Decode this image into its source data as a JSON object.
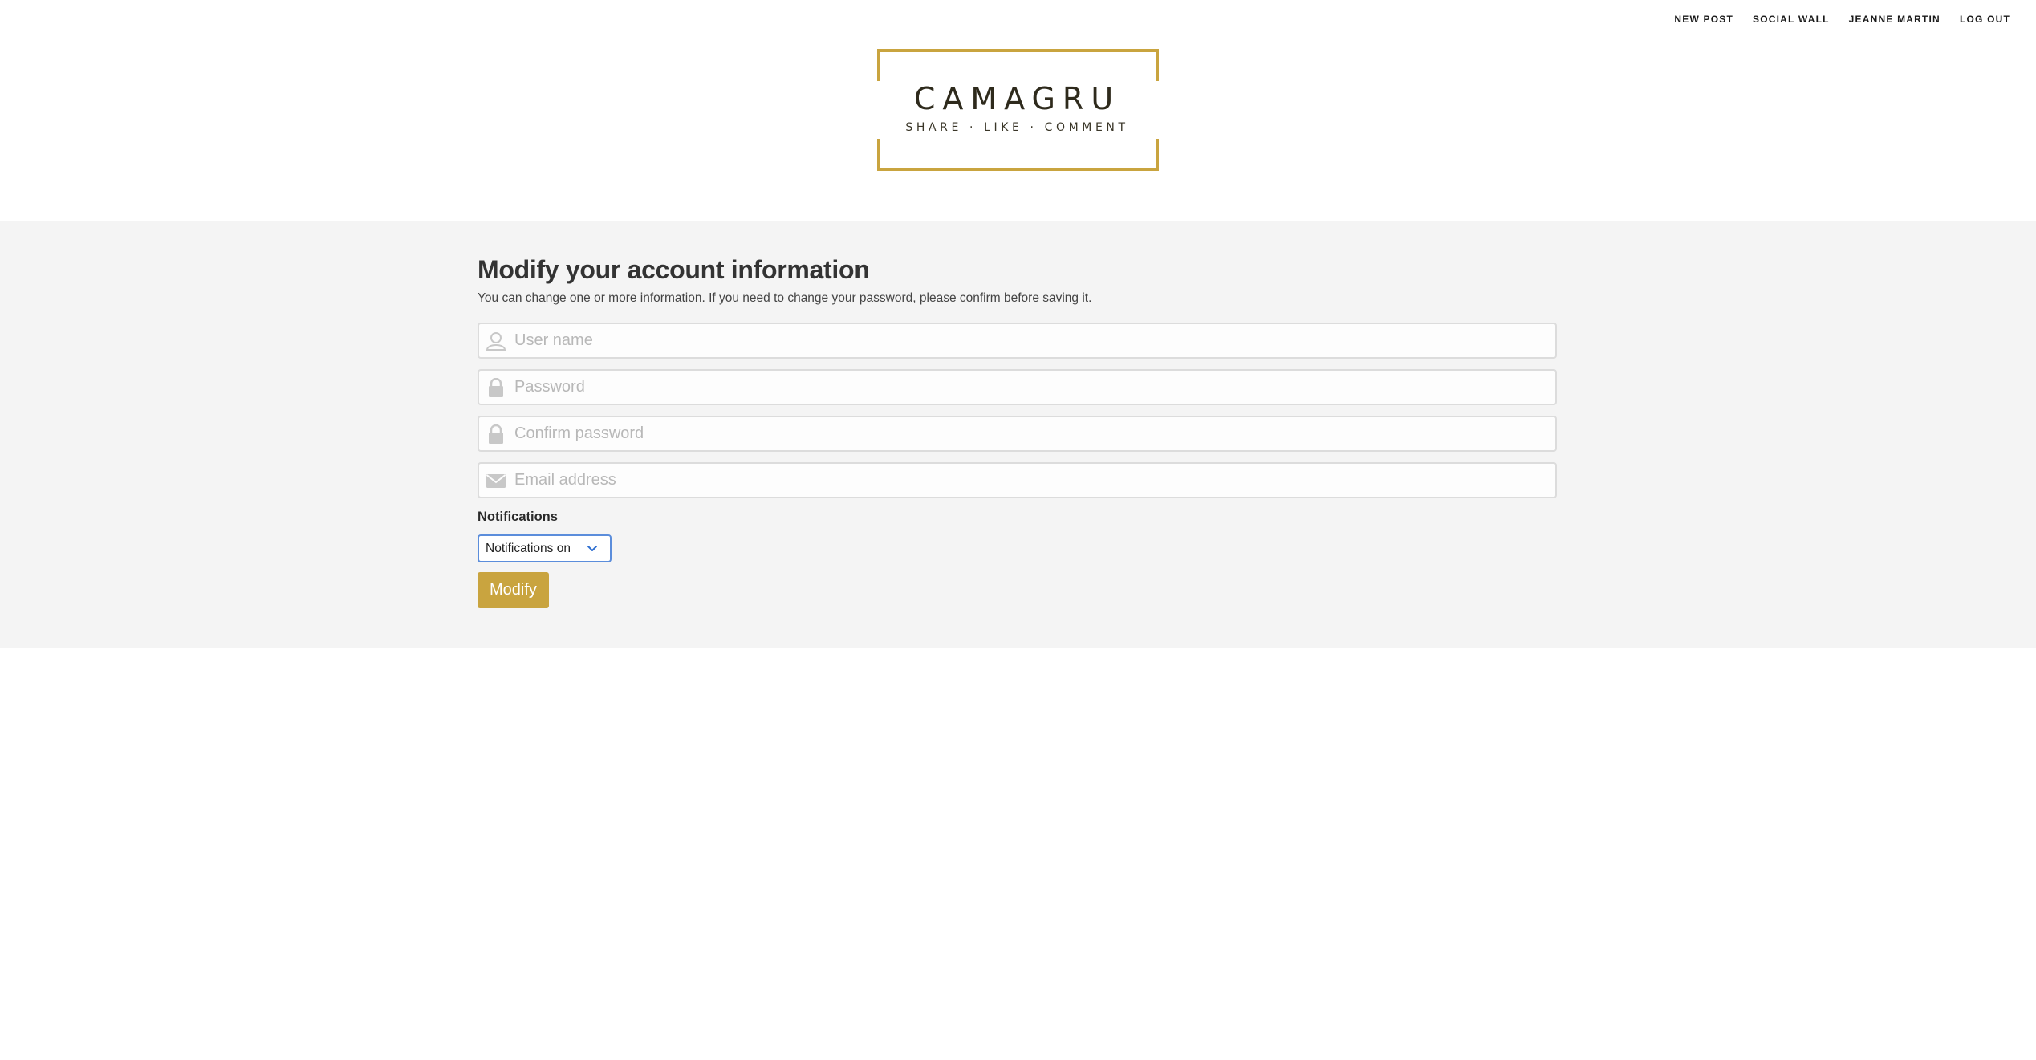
{
  "nav": {
    "items": [
      {
        "label": "NEW POST"
      },
      {
        "label": "SOCIAL WALL"
      },
      {
        "label": "JEANNE MARTIN"
      },
      {
        "label": "LOG OUT"
      }
    ]
  },
  "logo": {
    "title": "CAMAGRU",
    "tagline": "SHARE · LIKE · COMMENT",
    "accent_color": "#c9a43f"
  },
  "form": {
    "heading": "Modify your account information",
    "subtitle": "You can change one or more information. If you need to change your password, please confirm before saving it.",
    "fields": [
      {
        "icon": "user-icon",
        "placeholder": "User name",
        "value": ""
      },
      {
        "icon": "lock-icon",
        "placeholder": "Password",
        "value": ""
      },
      {
        "icon": "lock-icon",
        "placeholder": "Confirm password",
        "value": ""
      },
      {
        "icon": "envelope-icon",
        "placeholder": "Email address",
        "value": ""
      }
    ],
    "notifications_label": "Notifications",
    "notifications_selected": "Notifications on",
    "submit_label": "Modify"
  },
  "colors": {
    "accent": "#c9a43f",
    "band_background": "#f4f4f4",
    "select_focus_border": "#5b8ddb"
  }
}
